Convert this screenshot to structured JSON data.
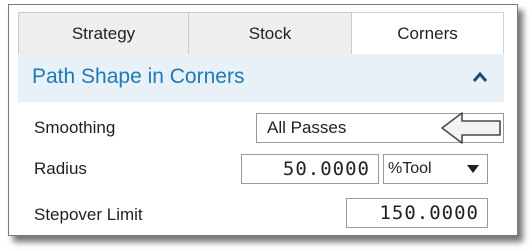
{
  "tabs": [
    {
      "label": "Strategy"
    },
    {
      "label": "Stock"
    },
    {
      "label": "Corners"
    }
  ],
  "section": {
    "title": "Path Shape in Corners",
    "icon": "chevron-up-icon"
  },
  "smoothing": {
    "label": "Smoothing",
    "value": "All Passes"
  },
  "radius": {
    "label": "Radius",
    "value": "50.0000",
    "unit": "%Tool"
  },
  "stepover_limit": {
    "label": "Stepover Limit",
    "value": "150.0000"
  },
  "colors": {
    "accent": "#1e7ab6",
    "header_bg": "#e9f1f8"
  }
}
